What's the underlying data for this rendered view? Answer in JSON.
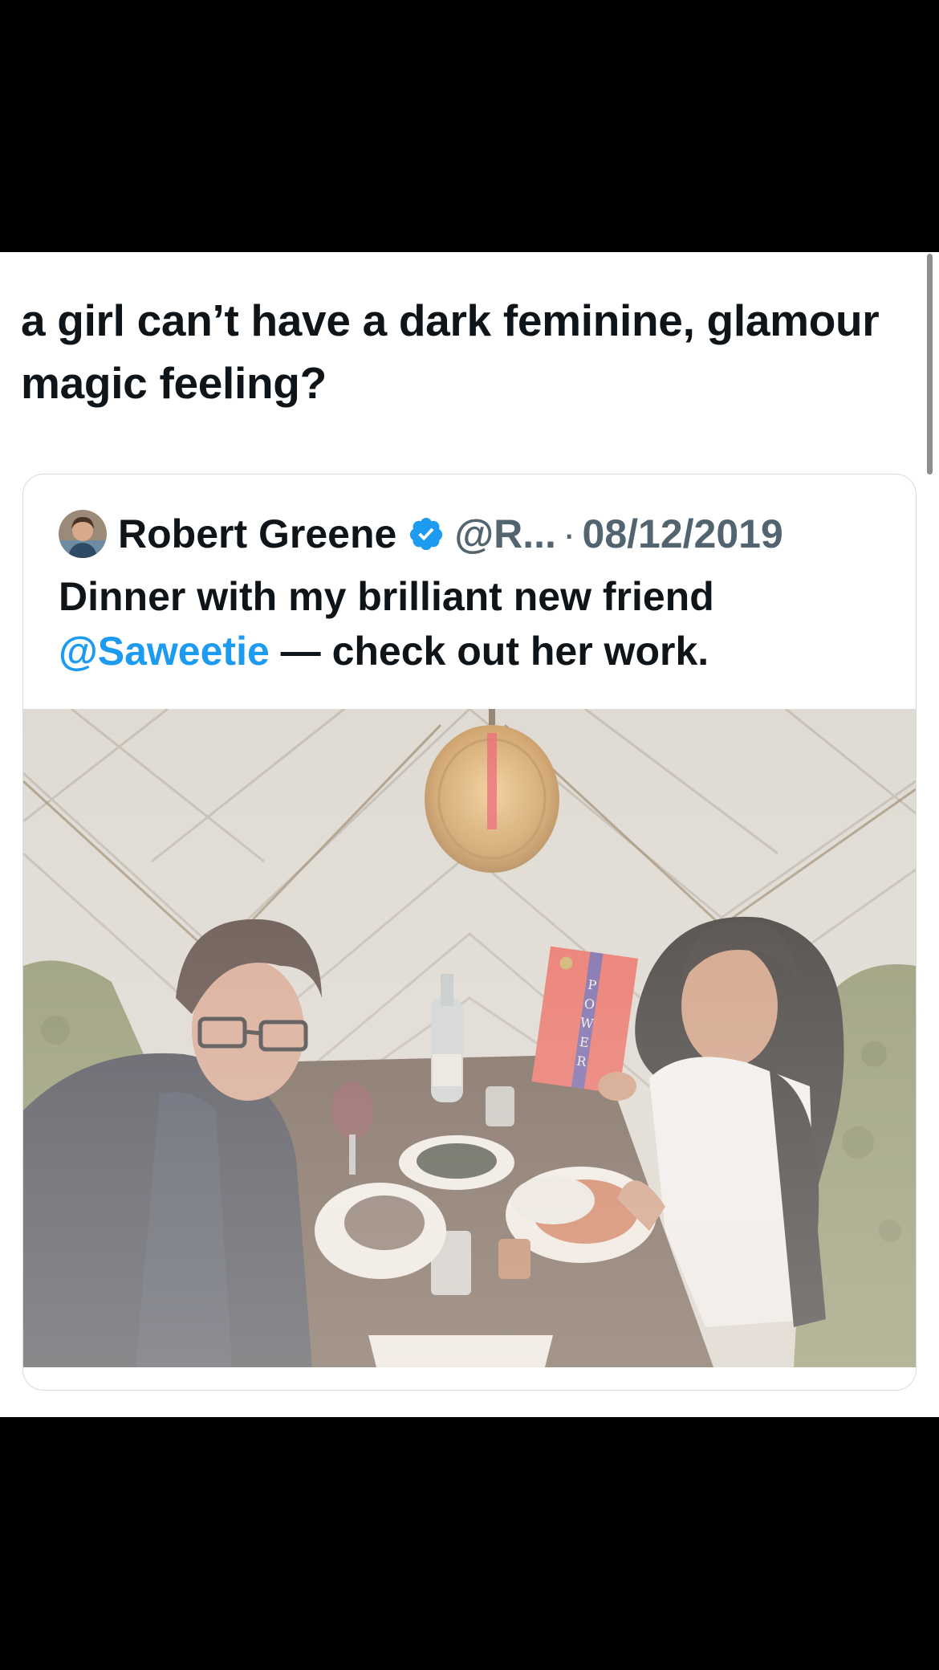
{
  "post": {
    "text": "a girl can’t have a dark feminine, glamour magic feeling?"
  },
  "quoted_post": {
    "author_name": "Robert Greene",
    "handle": "@R...",
    "separator": "·",
    "date": "08/12/2019",
    "text_before": "Dinner with my brilliant new friend ",
    "mention": "@Saweetie",
    "text_after": " — check out her work.",
    "verified_badge_color": "#1d9bf0",
    "avatar_icon": "avatar-photo",
    "book_title_on_cover": "POWER"
  },
  "colors": {
    "text": "#0f1419",
    "secondary_text": "#536471",
    "link": "#1d9bf0"
  }
}
